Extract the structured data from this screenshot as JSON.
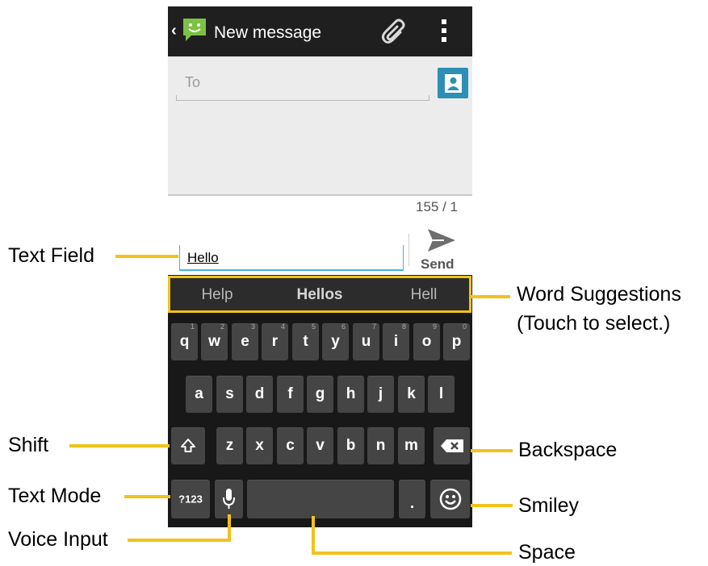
{
  "action_bar": {
    "title": "New message"
  },
  "compose": {
    "to_placeholder": "To",
    "counter": "155 / 1",
    "text_value": "Hello",
    "send_label": "Send"
  },
  "suggestions": [
    "Help",
    "Hellos",
    "Hell"
  ],
  "keyboard": {
    "row1": [
      {
        "k": "q",
        "h": "1"
      },
      {
        "k": "w",
        "h": "2"
      },
      {
        "k": "e",
        "h": "3"
      },
      {
        "k": "r",
        "h": "4"
      },
      {
        "k": "t",
        "h": "5"
      },
      {
        "k": "y",
        "h": "6"
      },
      {
        "k": "u",
        "h": "7"
      },
      {
        "k": "i",
        "h": "8"
      },
      {
        "k": "o",
        "h": "9"
      },
      {
        "k": "p",
        "h": "0"
      }
    ],
    "row2": [
      "a",
      "s",
      "d",
      "f",
      "g",
      "h",
      "j",
      "k",
      "l"
    ],
    "row3": [
      "z",
      "x",
      "c",
      "v",
      "b",
      "n",
      "m"
    ],
    "mode_key": "?123",
    "period_key": "."
  },
  "callouts": {
    "text_field": "Text Field",
    "word_suggestions_1": "Word Suggestions",
    "word_suggestions_2": "(Touch to select.)",
    "shift": "Shift",
    "backspace": "Backspace",
    "text_mode": "Text Mode",
    "smiley": "Smiley",
    "voice_input": "Voice Input",
    "space": "Space"
  },
  "colors": {
    "accent": "#f2c218",
    "action_bar": "#1f1f1f",
    "keyboard_bg": "#181818",
    "key_bg": "#454545",
    "input_underline": "#44b3dd",
    "contact_icon": "#2c8fb5"
  }
}
